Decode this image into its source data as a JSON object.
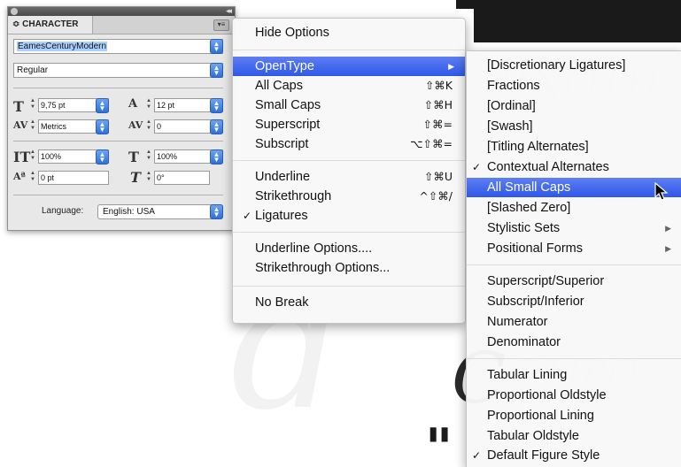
{
  "character_panel": {
    "tab_label": "CHARACTER",
    "font_family": "EamesCenturyModern",
    "font_style": "Regular",
    "font_size": "9,75 pt",
    "leading": "12 pt",
    "kerning": "Metrics",
    "tracking": "0",
    "vertical_scale": "100%",
    "horizontal_scale": "100%",
    "baseline_shift": "0 pt",
    "skew": "0°",
    "language_label": "Language:",
    "language_value": "English: USA"
  },
  "main_menu": {
    "hide_options": "Hide Options",
    "opentype": "OpenType",
    "all_caps": {
      "label": "All Caps",
      "shortcut": "⇧⌘K"
    },
    "small_caps": {
      "label": "Small Caps",
      "shortcut": "⇧⌘H"
    },
    "superscript": {
      "label": "Superscript",
      "shortcut": "⇧⌘="
    },
    "subscript": {
      "label": "Subscript",
      "shortcut": "⌥⇧⌘="
    },
    "underline": {
      "label": "Underline",
      "shortcut": "⇧⌘U"
    },
    "strikethrough": {
      "label": "Strikethrough",
      "shortcut": "^⇧⌘/"
    },
    "ligatures": "Ligatures",
    "underline_options": "Underline Options....",
    "strikethrough_options": "Strikethrough Options...",
    "no_break": "No Break"
  },
  "opentype_submenu": {
    "discretionary_ligatures": "[Discretionary Ligatures]",
    "fractions": "Fractions",
    "ordinal": "[Ordinal]",
    "swash": "[Swash]",
    "titling_alternates": "[Titling Alternates]",
    "contextual_alternates": "Contextual Alternates",
    "all_small_caps": "All Small Caps",
    "slashed_zero": "[Slashed Zero]",
    "stylistic_sets": "Stylistic Sets",
    "positional_forms": "Positional Forms",
    "superscript_superior": "Superscript/Superior",
    "subscript_inferior": "Subscript/Inferior",
    "numerator": "Numerator",
    "denominator": "Denominator",
    "tabular_lining": "Tabular Lining",
    "proportional_oldstyle": "Proportional Oldstyle",
    "proportional_lining": "Proportional Lining",
    "tabular_oldstyle": "Tabular Oldstyle",
    "default_figure_style": "Default Figure Style"
  },
  "colors": {
    "highlight": "#3a62ec",
    "menu_bg": "#f8f8f8",
    "panel_bg": "#e8e8e8"
  }
}
